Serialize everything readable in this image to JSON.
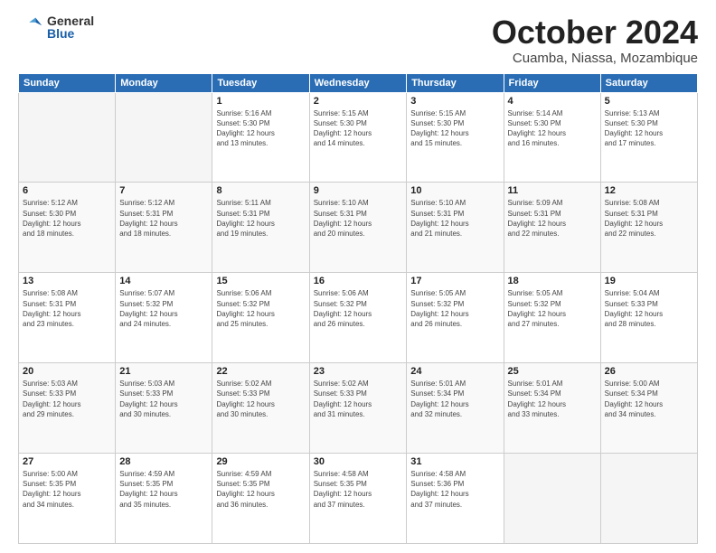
{
  "logo": {
    "general": "General",
    "blue": "Blue"
  },
  "header": {
    "month": "October 2024",
    "location": "Cuamba, Niassa, Mozambique"
  },
  "weekdays": [
    "Sunday",
    "Monday",
    "Tuesday",
    "Wednesday",
    "Thursday",
    "Friday",
    "Saturday"
  ],
  "weeks": [
    [
      {
        "day": "",
        "info": ""
      },
      {
        "day": "",
        "info": ""
      },
      {
        "day": "1",
        "info": "Sunrise: 5:16 AM\nSunset: 5:30 PM\nDaylight: 12 hours\nand 13 minutes."
      },
      {
        "day": "2",
        "info": "Sunrise: 5:15 AM\nSunset: 5:30 PM\nDaylight: 12 hours\nand 14 minutes."
      },
      {
        "day": "3",
        "info": "Sunrise: 5:15 AM\nSunset: 5:30 PM\nDaylight: 12 hours\nand 15 minutes."
      },
      {
        "day": "4",
        "info": "Sunrise: 5:14 AM\nSunset: 5:30 PM\nDaylight: 12 hours\nand 16 minutes."
      },
      {
        "day": "5",
        "info": "Sunrise: 5:13 AM\nSunset: 5:30 PM\nDaylight: 12 hours\nand 17 minutes."
      }
    ],
    [
      {
        "day": "6",
        "info": "Sunrise: 5:12 AM\nSunset: 5:30 PM\nDaylight: 12 hours\nand 18 minutes."
      },
      {
        "day": "7",
        "info": "Sunrise: 5:12 AM\nSunset: 5:31 PM\nDaylight: 12 hours\nand 18 minutes."
      },
      {
        "day": "8",
        "info": "Sunrise: 5:11 AM\nSunset: 5:31 PM\nDaylight: 12 hours\nand 19 minutes."
      },
      {
        "day": "9",
        "info": "Sunrise: 5:10 AM\nSunset: 5:31 PM\nDaylight: 12 hours\nand 20 minutes."
      },
      {
        "day": "10",
        "info": "Sunrise: 5:10 AM\nSunset: 5:31 PM\nDaylight: 12 hours\nand 21 minutes."
      },
      {
        "day": "11",
        "info": "Sunrise: 5:09 AM\nSunset: 5:31 PM\nDaylight: 12 hours\nand 22 minutes."
      },
      {
        "day": "12",
        "info": "Sunrise: 5:08 AM\nSunset: 5:31 PM\nDaylight: 12 hours\nand 22 minutes."
      }
    ],
    [
      {
        "day": "13",
        "info": "Sunrise: 5:08 AM\nSunset: 5:31 PM\nDaylight: 12 hours\nand 23 minutes."
      },
      {
        "day": "14",
        "info": "Sunrise: 5:07 AM\nSunset: 5:32 PM\nDaylight: 12 hours\nand 24 minutes."
      },
      {
        "day": "15",
        "info": "Sunrise: 5:06 AM\nSunset: 5:32 PM\nDaylight: 12 hours\nand 25 minutes."
      },
      {
        "day": "16",
        "info": "Sunrise: 5:06 AM\nSunset: 5:32 PM\nDaylight: 12 hours\nand 26 minutes."
      },
      {
        "day": "17",
        "info": "Sunrise: 5:05 AM\nSunset: 5:32 PM\nDaylight: 12 hours\nand 26 minutes."
      },
      {
        "day": "18",
        "info": "Sunrise: 5:05 AM\nSunset: 5:32 PM\nDaylight: 12 hours\nand 27 minutes."
      },
      {
        "day": "19",
        "info": "Sunrise: 5:04 AM\nSunset: 5:33 PM\nDaylight: 12 hours\nand 28 minutes."
      }
    ],
    [
      {
        "day": "20",
        "info": "Sunrise: 5:03 AM\nSunset: 5:33 PM\nDaylight: 12 hours\nand 29 minutes."
      },
      {
        "day": "21",
        "info": "Sunrise: 5:03 AM\nSunset: 5:33 PM\nDaylight: 12 hours\nand 30 minutes."
      },
      {
        "day": "22",
        "info": "Sunrise: 5:02 AM\nSunset: 5:33 PM\nDaylight: 12 hours\nand 30 minutes."
      },
      {
        "day": "23",
        "info": "Sunrise: 5:02 AM\nSunset: 5:33 PM\nDaylight: 12 hours\nand 31 minutes."
      },
      {
        "day": "24",
        "info": "Sunrise: 5:01 AM\nSunset: 5:34 PM\nDaylight: 12 hours\nand 32 minutes."
      },
      {
        "day": "25",
        "info": "Sunrise: 5:01 AM\nSunset: 5:34 PM\nDaylight: 12 hours\nand 33 minutes."
      },
      {
        "day": "26",
        "info": "Sunrise: 5:00 AM\nSunset: 5:34 PM\nDaylight: 12 hours\nand 34 minutes."
      }
    ],
    [
      {
        "day": "27",
        "info": "Sunrise: 5:00 AM\nSunset: 5:35 PM\nDaylight: 12 hours\nand 34 minutes."
      },
      {
        "day": "28",
        "info": "Sunrise: 4:59 AM\nSunset: 5:35 PM\nDaylight: 12 hours\nand 35 minutes."
      },
      {
        "day": "29",
        "info": "Sunrise: 4:59 AM\nSunset: 5:35 PM\nDaylight: 12 hours\nand 36 minutes."
      },
      {
        "day": "30",
        "info": "Sunrise: 4:58 AM\nSunset: 5:35 PM\nDaylight: 12 hours\nand 37 minutes."
      },
      {
        "day": "31",
        "info": "Sunrise: 4:58 AM\nSunset: 5:36 PM\nDaylight: 12 hours\nand 37 minutes."
      },
      {
        "day": "",
        "info": ""
      },
      {
        "day": "",
        "info": ""
      }
    ]
  ]
}
